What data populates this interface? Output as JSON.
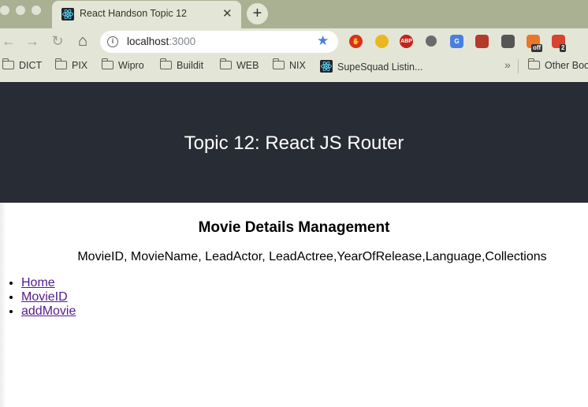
{
  "browser": {
    "tab": {
      "title": "React Handson Topic 12",
      "close": "✕"
    },
    "new_tab": "+",
    "nav": {
      "back": "←",
      "forward": "→",
      "reload": "↻",
      "home": "⌂"
    },
    "url": {
      "host": "localhost",
      "port": ":3000"
    },
    "extensions": [
      {
        "name": "adblock-hand-icon",
        "label": "",
        "color": "#d9311d"
      },
      {
        "name": "bee-icon",
        "label": "",
        "color": "#e9b820"
      },
      {
        "name": "abp-icon",
        "label": "ABP",
        "color": "#c0241c"
      },
      {
        "name": "record-icon",
        "label": "",
        "color": "#6b6b6b"
      },
      {
        "name": "translate-icon",
        "label": "G",
        "color": "#4a7fe0"
      },
      {
        "name": "tile-icon",
        "label": "",
        "color": "#b53a2a"
      },
      {
        "name": "bulb-icon",
        "label": "",
        "color": "#555555"
      },
      {
        "name": "off-toggle-icon",
        "label": "",
        "color": "#e8762b",
        "badge": "off"
      },
      {
        "name": "todoist-icon",
        "label": "",
        "color": "#d8432f",
        "badge": "2"
      }
    ],
    "bookmarks": [
      {
        "label": "DICT"
      },
      {
        "label": "PIX"
      },
      {
        "label": "Wipro"
      },
      {
        "label": "Buildit"
      },
      {
        "label": "WEB"
      },
      {
        "label": "NIX"
      },
      {
        "label": "SupeSquad Listin..."
      }
    ],
    "bookmarks_more": "»",
    "other_bookmarks": "Other Boo"
  },
  "page": {
    "header_title": "Topic 12: React JS Router",
    "heading": "Movie Details Management",
    "fields": "MovieID, MovieName, LeadActor, LeadActree,YearOfRelease,Language,Collections",
    "nav_links": [
      {
        "label": "Home"
      },
      {
        "label": "MovieID"
      },
      {
        "label": "addMovie"
      }
    ]
  }
}
